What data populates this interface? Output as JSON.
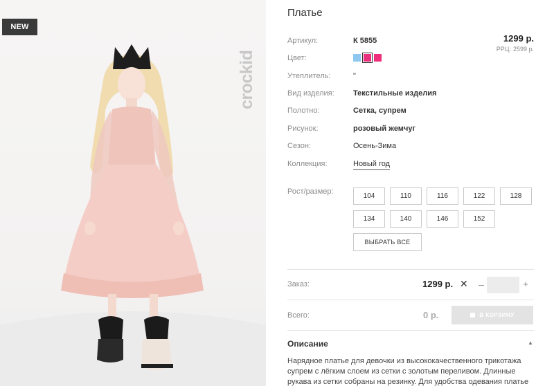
{
  "badge": "NEW",
  "brand": "crockid",
  "product": {
    "title": "Платье",
    "price": "1299 р.",
    "rrc_label": "РРЦ:",
    "rrc_value": "2599 р."
  },
  "attributes": [
    {
      "label": "Артикул:",
      "value": "К 5855"
    },
    {
      "label": "Цвет:",
      "value": ""
    },
    {
      "label": "Утеплитель:",
      "value": "\""
    },
    {
      "label": "Вид изделия:",
      "value": "Текстильные изделия"
    },
    {
      "label": "Полотно:",
      "value": "Сетка, супрем"
    },
    {
      "label": "Рисунок:",
      "value": "розовый жемчуг"
    },
    {
      "label": "Сезон:",
      "value": "Осень-Зима"
    },
    {
      "label": "Коллекция:",
      "value": "Новый год"
    }
  ],
  "colors": [
    {
      "name": "light-blue",
      "hex": "#8ec8f0",
      "selected": false
    },
    {
      "name": "pink",
      "hex": "#e8307c",
      "selected": true
    },
    {
      "name": "pink-2",
      "hex": "#ef2f7a",
      "selected": false
    }
  ],
  "sizes": {
    "label": "Рост/размер:",
    "items": [
      "104",
      "110",
      "116",
      "122",
      "128",
      "134",
      "140",
      "146",
      "152"
    ],
    "select_all": "ВЫБРАТЬ ВСЕ"
  },
  "order": {
    "label": "Заказ:",
    "price": "1299 р.",
    "times": "✕",
    "minus": "–",
    "plus": "+",
    "qty": ""
  },
  "total": {
    "label": "Всего:",
    "value": "0 р.",
    "cart_button": "В КОРЗИНУ"
  },
  "description": {
    "heading": "Описание",
    "text": "Нарядное платье для девочки из высококачественного трикотажа супрем с лёгким слоем из сетки с золотым переливом. Длинные рукава из сетки собраны на резинку. Для удобства одевания платье"
  }
}
